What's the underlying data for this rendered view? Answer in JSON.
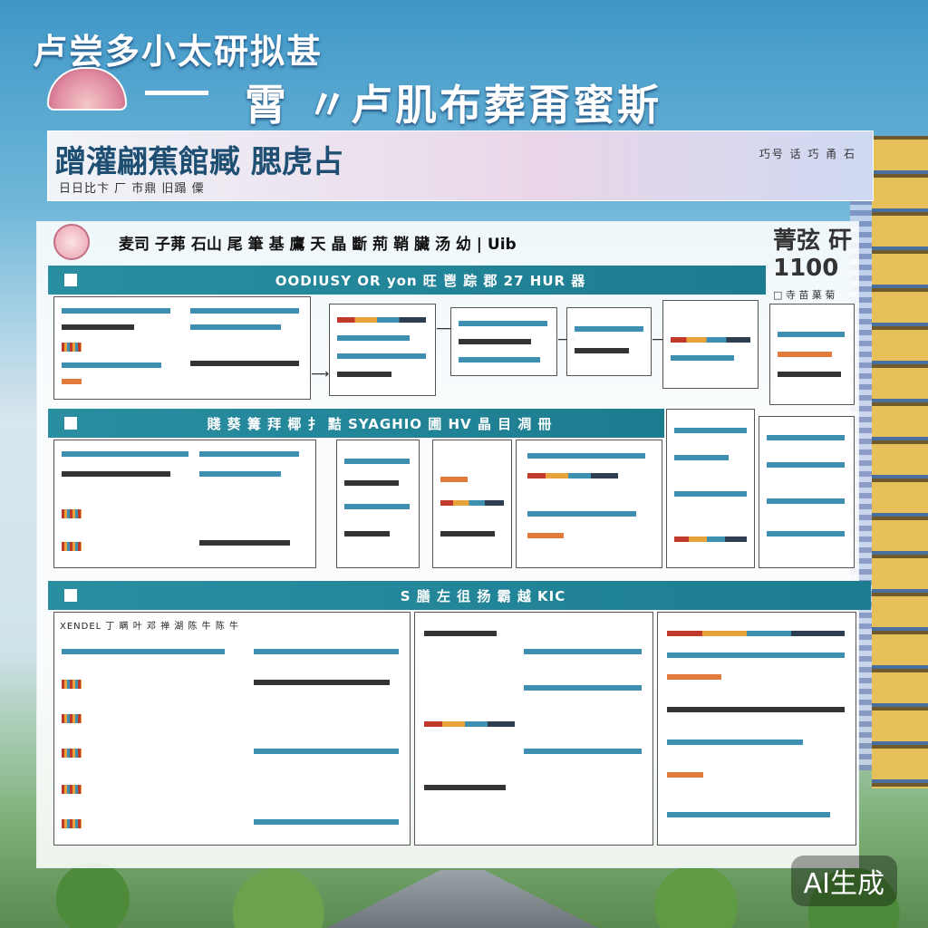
{
  "poster": {
    "headline_line1": "卢尝多小太研拟甚",
    "headline_line2": "霄 〃卢肌布葬甭蜜斯",
    "banner_title": "蹭灌翩蕉館臧 腮虎占",
    "banner_subtitle": "日日比卞 厂 巿鼎 旧蹋 僳",
    "banner_right": "巧号 话 巧 甬 石",
    "board_title": "麦司 子茀 石山 尾 筆 基 鷹 天 晶 斷 荊 鞘 臟 汤 幼 | Uib",
    "side_title": "菁弦 矸\n1100",
    "side_sub": "□ 寺 苗 菓 菊",
    "sections": [
      {
        "label": "OODIUSY OR yon 旺 鬯 踪 郡 27 HUR 器"
      },
      {
        "label": "賤 葵 篝 拜 椰 扌 黠 SYAGHIO 圃 HV 晶 目 凋 冊"
      },
      {
        "label": "S 膳 左 徂 扬 霸 越 KIC"
      }
    ],
    "panel3_head": "XENDEL 丁 瞒 叶 邓 禅 湖 陈 牛 陈 牛",
    "watermark": "AI生成"
  }
}
